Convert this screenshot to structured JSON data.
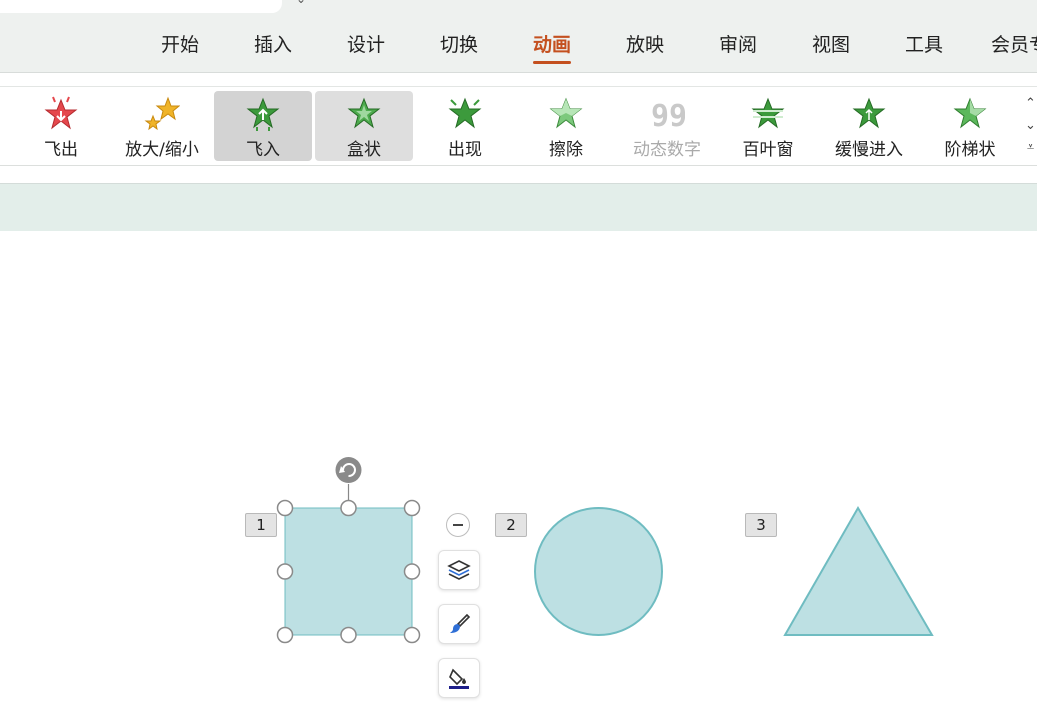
{
  "menu": {
    "tabs": [
      {
        "label": "开始"
      },
      {
        "label": "插入"
      },
      {
        "label": "设计"
      },
      {
        "label": "切换"
      },
      {
        "label": "动画",
        "active": true
      },
      {
        "label": "放映"
      },
      {
        "label": "审阅"
      },
      {
        "label": "视图"
      },
      {
        "label": "工具"
      },
      {
        "label": "会员专"
      }
    ],
    "active_color": "#c4501f"
  },
  "ribbon": {
    "effects": [
      {
        "label": "飞出",
        "icon": "star-fly-out-icon",
        "color": "#e5484d"
      },
      {
        "label": "放大/缩小",
        "icon": "star-zoom-icon",
        "color": "#f0b429"
      },
      {
        "label": "飞入",
        "icon": "star-fly-in-icon",
        "color": "#3c9a3c",
        "state": "selected"
      },
      {
        "label": "盒状",
        "icon": "star-box-icon",
        "color": "#3c9a3c",
        "state": "hover"
      },
      {
        "label": "出现",
        "icon": "star-appear-icon",
        "color": "#3c9a3c"
      },
      {
        "label": "擦除",
        "icon": "star-wipe-icon",
        "color": "#5cb85c"
      },
      {
        "label": "动态数字",
        "icon": "dynamic-number-icon",
        "disabled": true
      },
      {
        "label": "百叶窗",
        "icon": "star-blinds-icon",
        "color": "#3c9a3c"
      },
      {
        "label": "缓慢进入",
        "icon": "star-ease-in-icon",
        "color": "#3c9a3c"
      },
      {
        "label": "阶梯状",
        "icon": "star-stairs-icon",
        "color": "#5cb85c"
      }
    ]
  },
  "canvas": {
    "shape_fill": "#bde0e3",
    "shape_stroke": "#6fbcc1",
    "tags": [
      "1",
      "2",
      "3"
    ]
  }
}
